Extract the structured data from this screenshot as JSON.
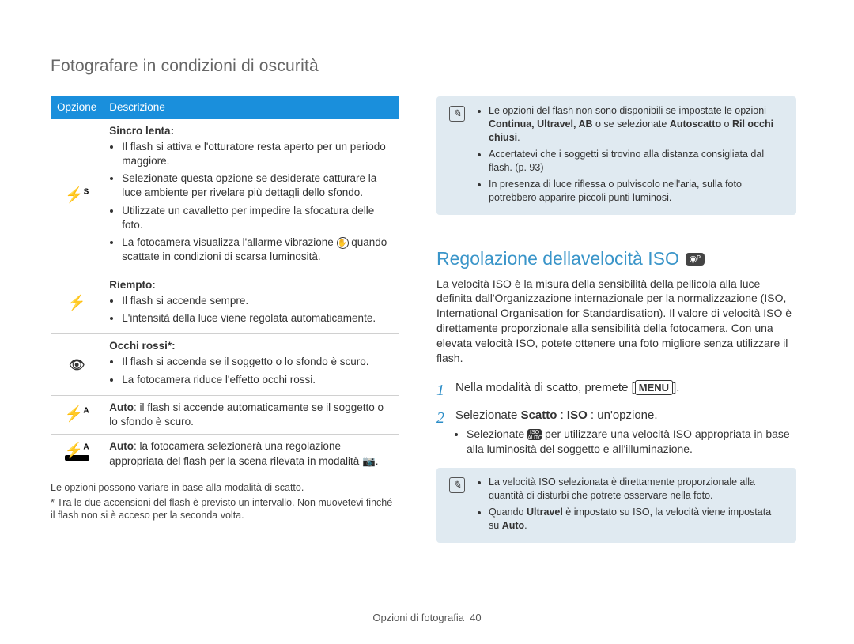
{
  "header": "Fotografare in condizioni di oscurità",
  "table": {
    "headers": {
      "opt": "Opzione",
      "desc": "Descrizione"
    },
    "rows": [
      {
        "icon": "slow-sync-icon",
        "glyph": "⚡ˢ",
        "title": "Sincro lenta:",
        "items": [
          "Il flash si attiva e l'otturatore resta aperto per un periodo maggiore.",
          "Selezionate questa opzione se desiderate catturare la luce ambiente per rivelare più dettagli dello sfondo.",
          "Utilizzate un cavalletto per impedire la sfocatura delle foto.",
          "La fotocamera visualizza l'allarme vibrazione (✋) quando scattate in condizioni di scarsa luminosità."
        ]
      },
      {
        "icon": "fill-flash-icon",
        "glyph": "⚡",
        "title": "Riempto:",
        "items": [
          "Il flash si accende sempre.",
          "L'intensità della luce viene regolata automaticamente."
        ]
      },
      {
        "icon": "red-eye-icon",
        "glyph": "👁",
        "title": "Occhi rossi*:",
        "items": [
          "Il flash si accende se il soggetto o lo sfondo è scuro.",
          "La fotocamera riduce l'effetto occhi rossi."
        ]
      },
      {
        "icon": "auto-flash-icon",
        "glyph": "⚡ᴬ",
        "plain_pre": "Auto",
        "plain": ": il flash si accende automaticamente se il soggetto o lo sfondo è scuro."
      },
      {
        "icon": "auto-smart-flash-icon",
        "glyph": "⚡ᴬ",
        "plain_pre": "Auto",
        "plain": ": la fotocamera selezionerà una regolazione appropriata del flash per la scena rilevata in modalità 📷."
      }
    ]
  },
  "footnotes": [
    "Le opzioni possono variare in base alla modalità di scatto.",
    "* Tra le due accensioni del flash è previsto un intervallo. Non muovetevi finché il flash non si è acceso per la seconda volta."
  ],
  "note_top": {
    "items": [
      {
        "pre": "Le opzioni del flash non sono disponibili se impostate le opzioni ",
        "bold": "Continua, Ultravel, AB",
        "mid": " o se selezionate ",
        "bold2": "Autoscatto",
        "mid2": " o ",
        "bold3": "Ril occhi chiusi",
        "post": "."
      },
      {
        "text": "Accertatevi che i soggetti si trovino alla distanza consigliata dal flash. (p. 93)"
      },
      {
        "text": "In presenza di luce riflessa o pulviscolo nell'aria, sulla foto potrebbero apparire piccoli punti luminosi."
      }
    ]
  },
  "iso_section": {
    "title": "Regolazione dellavelocità ISO",
    "body": "La velocità ISO è la misura della sensibilità della pellicola alla luce definita dall'Organizzazione internazionale per la normalizzazione (ISO, International Organisation for Standardisation). Il valore di velocità ISO è direttamente proporzionale alla sensibilità della fotocamera. Con una elevata velocità ISO, potete ottenere una foto migliore senza utilizzare il flash.",
    "steps": [
      {
        "n": "1",
        "pre": "Nella modalità di scatto, premete [",
        "btn": "MENU",
        "post": "]."
      },
      {
        "n": "2",
        "pre": "Selezionate ",
        "b1": "Scatto",
        "mid1": "  : ",
        "b2": "ISO",
        "mid2": "  : un'opzione.",
        "sub": {
          "pre": "Selezionate ",
          "icon": "iso-auto-icon",
          "post": " per utilizzare una velocità ISO appropriata in base alla luminosità del soggetto e all'illuminazione."
        }
      }
    ]
  },
  "note_bottom": {
    "items": [
      "La velocità ISO selezionata è direttamente proporzionale alla quantità di disturbi che potrete osservare nella foto.",
      {
        "pre": "Quando ",
        "b": "Ultravel",
        "mid": " è impostato su ISO, la velocità viene impostata su ",
        "b2": "Auto",
        "post": "."
      }
    ]
  },
  "footer": {
    "label": "Opzioni di fotografia",
    "page": "40"
  }
}
